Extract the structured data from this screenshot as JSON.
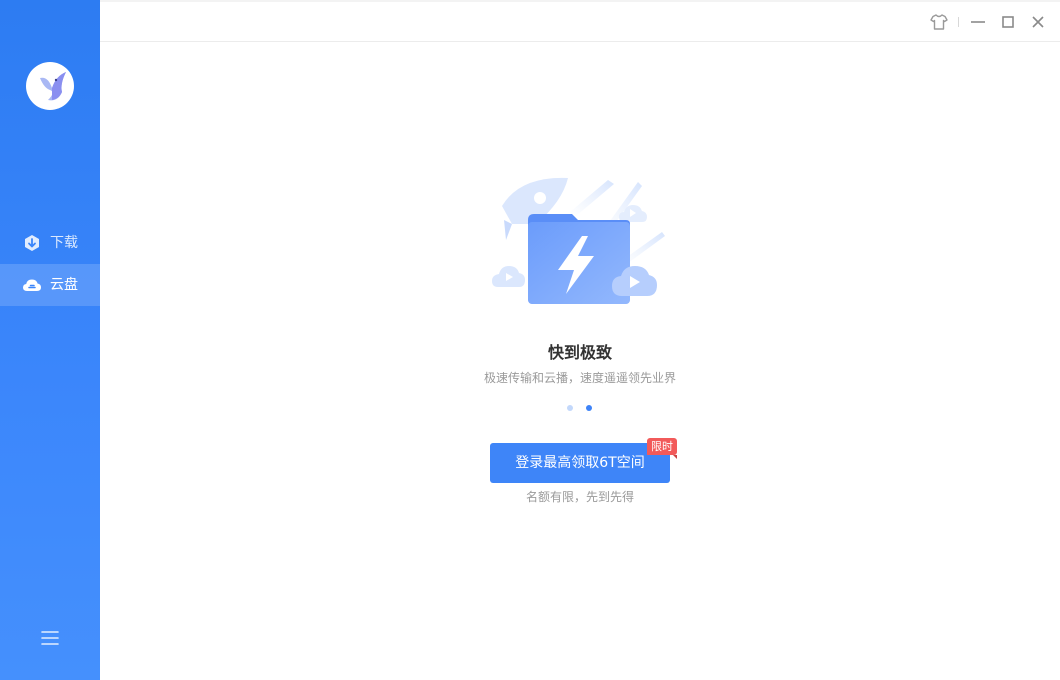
{
  "sidebar": {
    "logo_icon": "hummingbird-logo-icon",
    "items": [
      {
        "label": "下载",
        "icon": "download-icon",
        "active": false
      },
      {
        "label": "云盘",
        "icon": "cloud-drive-icon",
        "active": true
      }
    ],
    "menu_icon": "menu-icon"
  },
  "titlebar": {
    "buttons": [
      "skin-icon",
      "minimize-icon",
      "maximize-icon",
      "close-icon"
    ]
  },
  "main": {
    "illustration_icon": "folder-lightning-icon",
    "headline": "快到极致",
    "subline": "极速传输和云播，速度遥遥领先业界",
    "carousel": {
      "count": 2,
      "active_index": 1
    },
    "cta_label": "登录最高领取6T空间",
    "badge": "限时",
    "note": "名额有限，先到先得"
  },
  "colors": {
    "sidebar": "#3482f7",
    "primary": "#3e85f8",
    "badge": "#f25a5a"
  }
}
